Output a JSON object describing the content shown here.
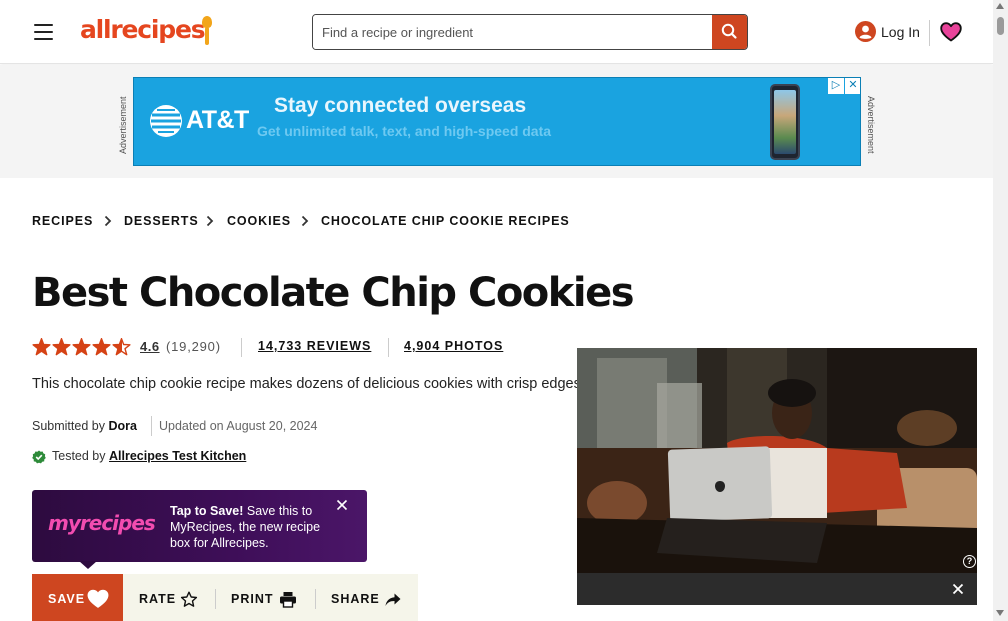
{
  "header": {
    "logo_text": "allrecipes",
    "search_placeholder": "Find a recipe or ingredient",
    "login_label": "Log In"
  },
  "advertisement": {
    "side_label": "Advertisement",
    "brand": "AT&T",
    "headline": "Stay connected overseas",
    "subline": "Get unlimited talk, text, and high-speed data",
    "brand_color": "#1aa3e0"
  },
  "breadcrumb": {
    "items": [
      {
        "label": "RECIPES"
      },
      {
        "label": "DESSERTS"
      },
      {
        "label": "COOKIES"
      },
      {
        "label": "CHOCOLATE CHIP COOKIE RECIPES"
      }
    ]
  },
  "recipe": {
    "title": "Best Chocolate Chip Cookies",
    "rating": "4.6",
    "rating_stars": 4.5,
    "rating_count": "(19,290)",
    "reviews": "14,733 REVIEWS",
    "photos": "4,904 PHOTOS",
    "description": "This chocolate chip cookie recipe makes dozens of delicious cookies with crisp edges and chewy middles.",
    "submitted_prefix": "Submitted by",
    "author": "Dora",
    "updated": "Updated on August 20, 2024",
    "tested_prefix": "Tested by",
    "tested_by": "Allrecipes Test Kitchen"
  },
  "promo": {
    "logo_my": "my",
    "logo_recipes": "recipes",
    "bold_text": "Tap to Save!",
    "text": "Save this to MyRecipes, the new recipe box for Allrecipes."
  },
  "actions": {
    "save": "SAVE",
    "rate": "RATE",
    "print": "PRINT",
    "share": "SHARE"
  },
  "colors": {
    "brand_orange": "#ce4620",
    "star": "#d54215",
    "promo_pink": "#f24cb0",
    "heart_pink": "#e8439a",
    "check_green": "#2e8b3a"
  }
}
